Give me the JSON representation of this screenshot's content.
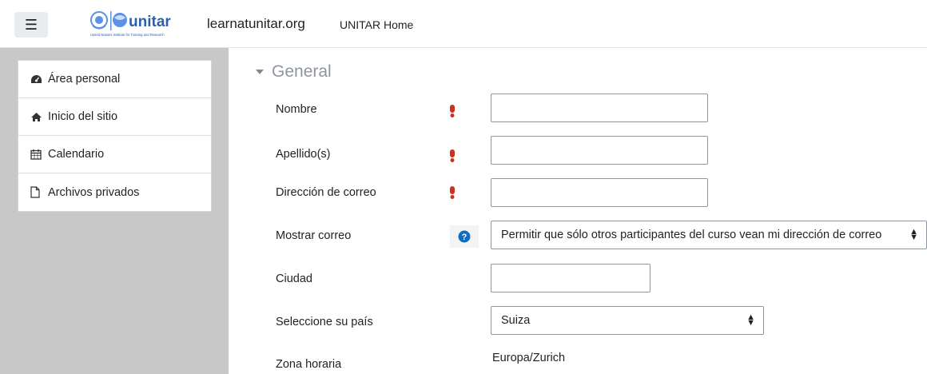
{
  "navbar": {
    "toggle_icon": "hamburger-icon",
    "logo_text": "unitar",
    "logo_caption": "United Nations Institute for Training and Research",
    "site_name": "learnatunitar.org",
    "home_link": "UNITAR Home"
  },
  "drawer": {
    "items": [
      {
        "label": "Área personal",
        "icon": "dashboard-icon"
      },
      {
        "label": "Inicio del sitio",
        "icon": "home-icon"
      },
      {
        "label": "Calendario",
        "icon": "calendar-icon"
      },
      {
        "label": "Archivos privados",
        "icon": "file-icon"
      }
    ]
  },
  "form": {
    "section_title": "General",
    "fields": {
      "nombre": {
        "label": "Nombre",
        "value": ""
      },
      "apellido": {
        "label": "Apellido(s)",
        "value": ""
      },
      "correo": {
        "label": "Dirección de correo",
        "value": ""
      },
      "mostrar_correo": {
        "label": "Mostrar correo",
        "value": "Permitir que sólo otros participantes del curso vean mi dirección de correo"
      },
      "ciudad": {
        "label": "Ciudad",
        "value": ""
      },
      "pais": {
        "label": "Seleccione su país",
        "value": "Suiza"
      },
      "zona": {
        "label": "Zona horaria",
        "value": "Europa/Zurich"
      }
    }
  },
  "colors": {
    "required": "#ca3120",
    "help": "#0f6cbf",
    "drawer_bg": "#c8c8c8"
  }
}
